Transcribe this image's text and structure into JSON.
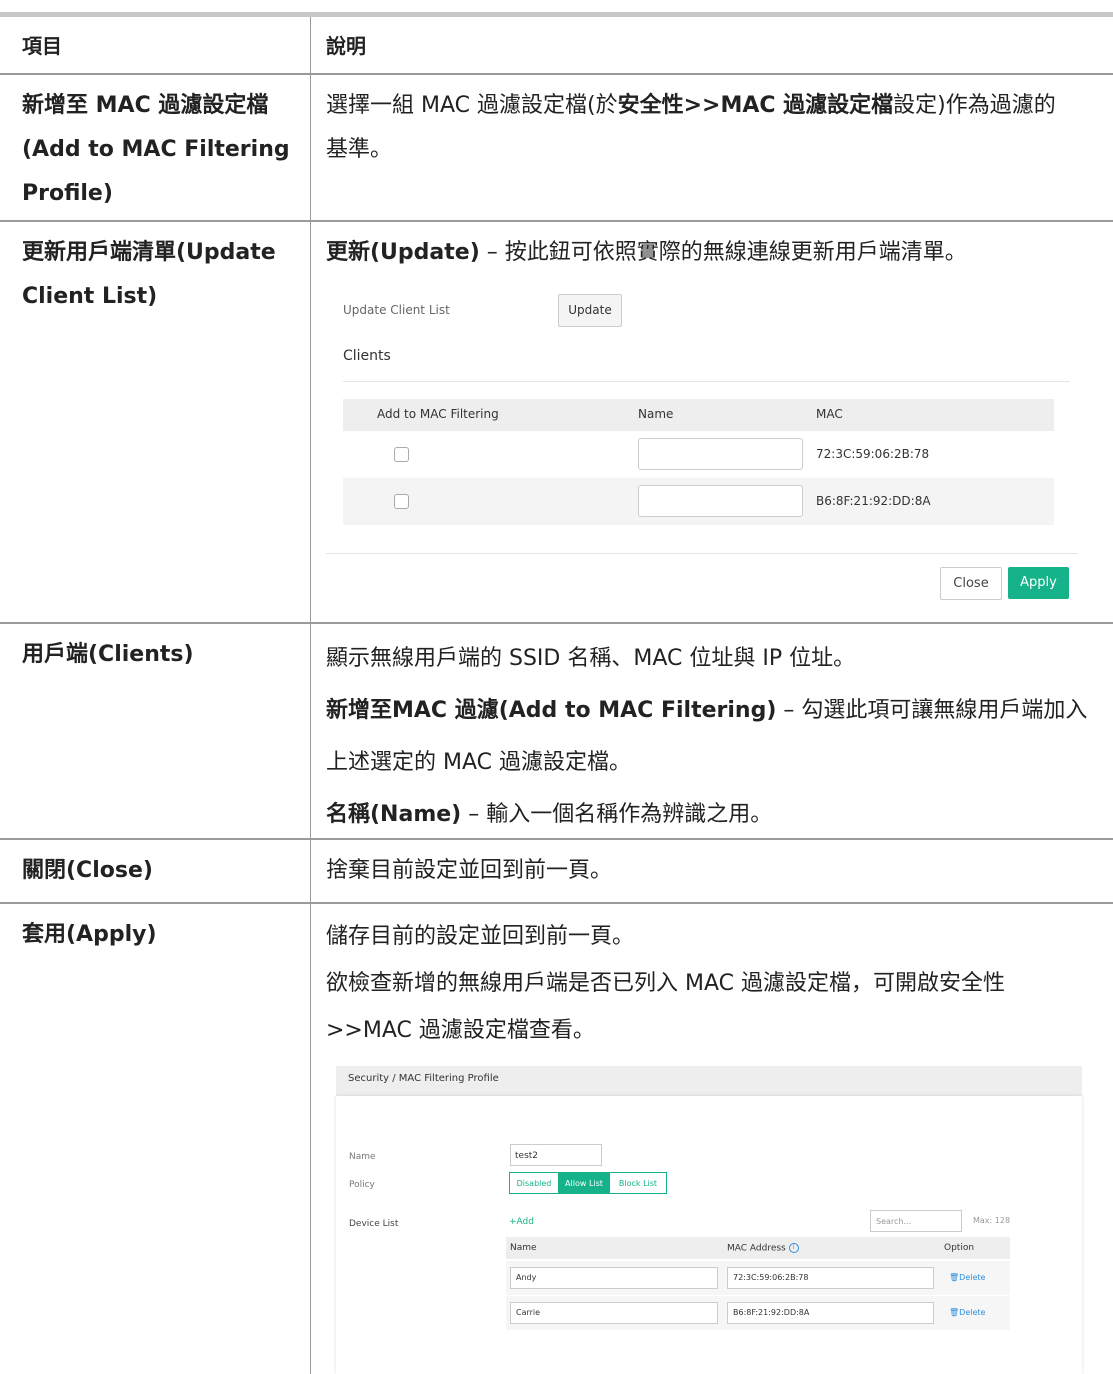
{
  "header": {
    "col1": "項目",
    "col2": "說明"
  },
  "rows": {
    "r1": {
      "item": [
        "新增至 MAC 過濾設定檔",
        "(Add to MAC Filtering",
        "Profile)"
      ],
      "desc_a": "選擇一組 MAC 過濾設定檔(於",
      "desc_b": "安全性>>MAC 過濾設定檔",
      "desc_c": "設定)作為過濾的",
      "desc_d": "基準。"
    },
    "r2": {
      "item": [
        "更新用戶端清單(Update",
        "Client List)"
      ],
      "desc_bold": "更新(Update)",
      "desc_rest": " – 按此鈕可依照實際的無線連線更新用戶端清單。"
    },
    "r3": {
      "item": "用戶端(Clients)",
      "line1": "顯示無線用戶端的 SSID 名稱、MAC 位址與 IP 位址。",
      "line2_bold": "新增至MAC 過濾(Add to MAC Filtering)",
      "line2_rest": " – 勾選此項可讓無線用戶端加入",
      "line3": "上述選定的 MAC 過濾設定檔。",
      "line4_bold": "名稱(Name)",
      "line4_rest": " – 輸入一個名稱作為辨識之用。"
    },
    "r4": {
      "item": "關閉(Close)",
      "desc": "捨棄目前設定並回到前一頁。"
    },
    "r5": {
      "item": "套用(Apply)",
      "line1": "儲存目前的設定並回到前一頁。",
      "line2": "欲檢查新增的無線用戶端是否已列入 MAC 過濾設定檔，可開啟安全性",
      "line3": ">>MAC 過濾設定檔查看。"
    }
  },
  "screenshot1": {
    "update_label": "Update Client List",
    "update_button": "Update",
    "clients_title": "Clients",
    "columns": [
      "Add to MAC Filtering",
      "Name",
      "MAC"
    ],
    "clients": [
      {
        "checked": false,
        "name": "",
        "mac": "72:3C:59:06:2B:78"
      },
      {
        "checked": false,
        "name": "",
        "mac": "B6:8F:21:92:DD:8A"
      }
    ],
    "close_button": "Close",
    "apply_button": "Apply"
  },
  "screenshot2": {
    "breadcrumb": "Security / MAC Filtering Profile",
    "name_label": "Name",
    "name_value": "test2",
    "policy_label": "Policy",
    "policy_options": [
      "Disabled",
      "Allow List",
      "Block List"
    ],
    "policy_selected": "Allow List",
    "device_list_label": "Device List",
    "add_label": "+Add",
    "search_placeholder": "Search...",
    "max_label": "Max: 128",
    "columns": [
      "Name",
      "MAC Address",
      "Option"
    ],
    "devices": [
      {
        "name": "Andy",
        "mac": "72:3C:59:06:2B:78",
        "action": "Delete"
      },
      {
        "name": "Carrie",
        "mac": "B6:8F:21:92:DD:8A",
        "action": "Delete"
      }
    ]
  },
  "colors": {
    "accent": "#16b38a",
    "link": "#2f8fe0"
  }
}
